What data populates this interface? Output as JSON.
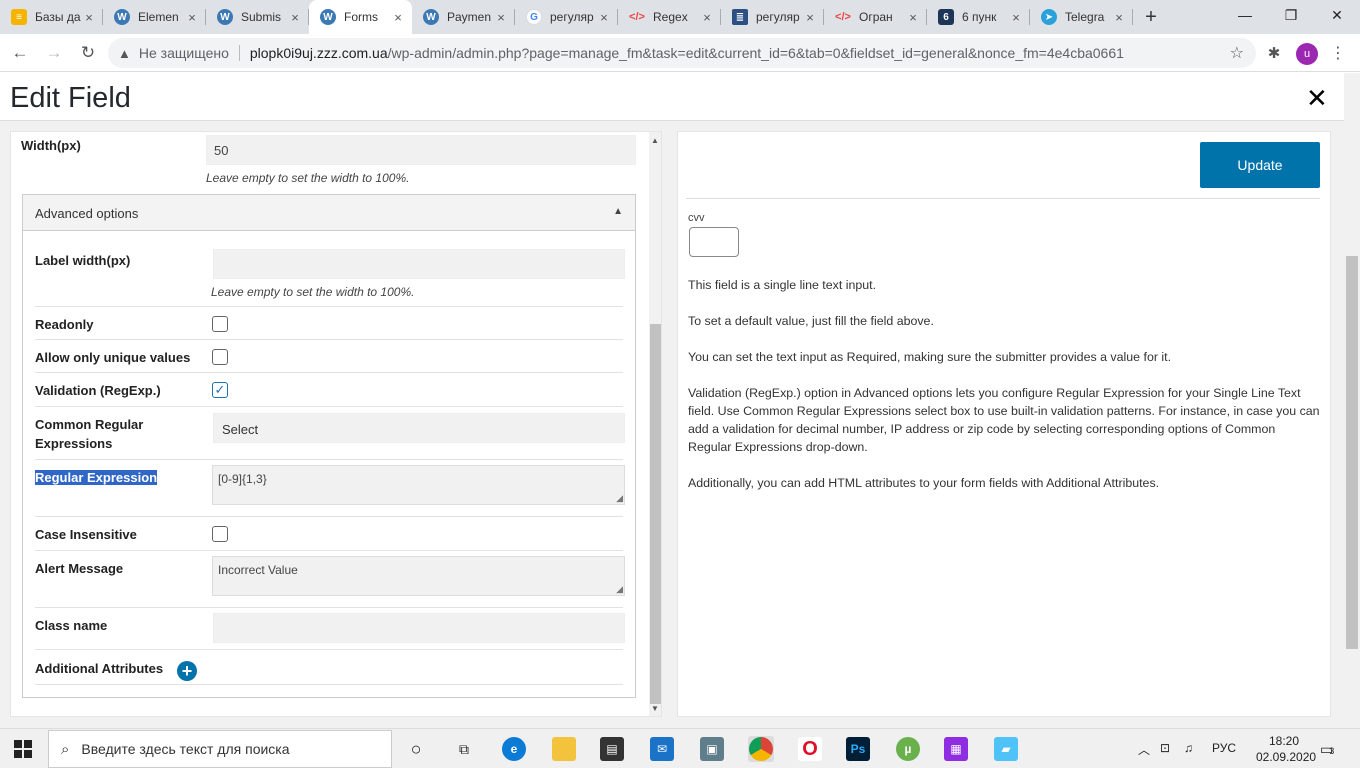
{
  "browser": {
    "tabs": [
      {
        "title": "Базы да",
        "icon": "db"
      },
      {
        "title": "Elemen",
        "icon": "wp"
      },
      {
        "title": "Submis",
        "icon": "wp"
      },
      {
        "title": "Forms",
        "icon": "wp",
        "active": true
      },
      {
        "title": "Paymen",
        "icon": "wp"
      },
      {
        "title": "регуляр",
        "icon": "g"
      },
      {
        "title": "Regex",
        "icon": "code"
      },
      {
        "title": "регуляр",
        "icon": "doc"
      },
      {
        "title": "Огран",
        "icon": "code"
      },
      {
        "title": "6 пунк",
        "icon": "vk"
      },
      {
        "title": "Telegra",
        "icon": "tg"
      }
    ],
    "new_tab": "+",
    "security_label": "Не защищено",
    "url_host": "plopk0i9uj.zzz.com.ua",
    "url_path": "/wp-admin/admin.php?page=manage_fm&task=edit&current_id=6&tab=0&fieldset_id=general&nonce_fm=4e4cba0661",
    "profile_initial": "u"
  },
  "page": {
    "title": "Edit Field",
    "close": "✕"
  },
  "left": {
    "width_label": "Width(px)",
    "width_value": "50",
    "width_hint": "Leave empty to set the width to 100%.",
    "advanced_title": "Advanced options",
    "label_width_label": "Label width(px)",
    "label_width_value": "",
    "label_width_hint": "Leave empty to set the width to 100%.",
    "readonly_label": "Readonly",
    "readonly_checked": false,
    "unique_label": "Allow only unique values",
    "unique_checked": false,
    "validation_label": "Validation (RegExp.)",
    "validation_checked": true,
    "common_regex_label_1": "Common Regular",
    "common_regex_label_2": "Expressions",
    "common_regex_value": "Select",
    "regex_label": "Regular Expression",
    "regex_value": "[0-9]{1,3}",
    "case_label": "Case Insensitive",
    "case_checked": false,
    "alert_label": "Alert Message",
    "alert_value": "Incorrect Value",
    "class_label": "Class name",
    "class_value": "",
    "attrs_label": "Additional Attributes"
  },
  "right": {
    "update_label": "Update",
    "preview_label": "cvv",
    "preview_value": "",
    "desc": [
      "This field is a single line text input.",
      "To set a default value, just fill the field above.",
      "You can set the text input as Required, making sure the submitter provides a value for it.",
      "Validation (RegExp.) option in Advanced options lets you configure Regular Expression for your Single Line Text field. Use Common Regular Expressions select box to use built-in validation patterns. For instance, in case you can add a validation for decimal number, IP address or zip code by selecting corresponding options of Common Regular Expressions drop-down.",
      "Additionally, you can add HTML attributes to your form fields with Additional Attributes."
    ]
  },
  "taskbar": {
    "search_placeholder": "Введите здесь текст для поиска",
    "lang": "РУС",
    "time": "18:20",
    "date": "02.09.2020",
    "notifications": "3"
  },
  "colors": {
    "accent": "#0073aa",
    "selection": "#3067c7"
  }
}
